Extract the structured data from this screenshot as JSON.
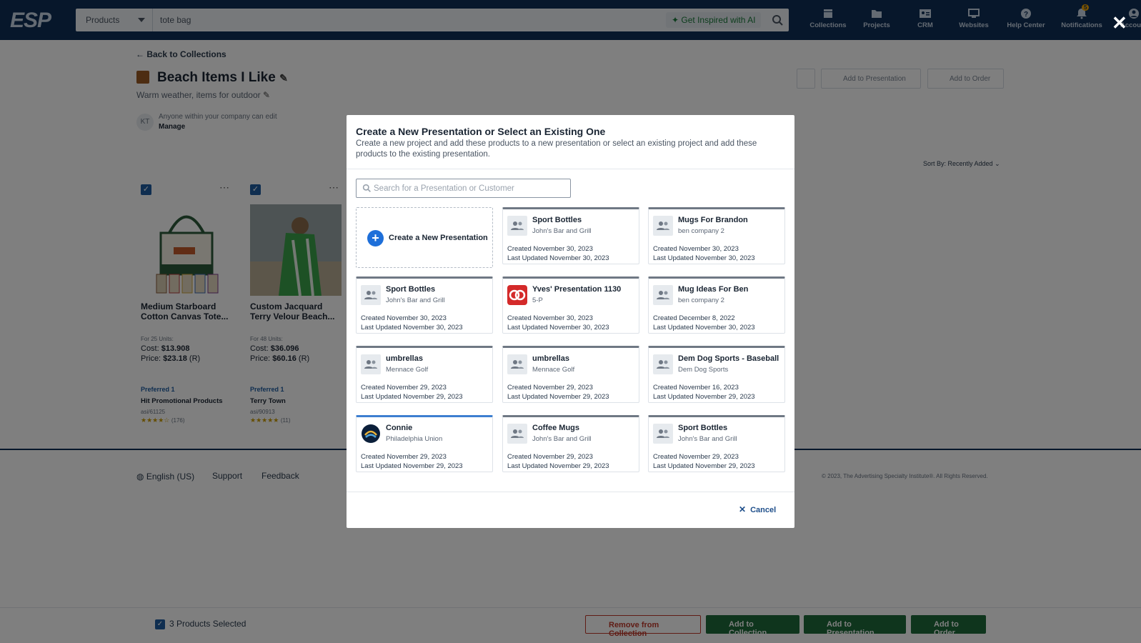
{
  "nav": {
    "logo": "ESP",
    "search_category": "Products",
    "search_query": "tote bag",
    "ai_button": "Get Inspired with AI",
    "items": [
      {
        "label": "Collections",
        "icon": "collections-icon"
      },
      {
        "label": "Projects",
        "icon": "folder-icon"
      },
      {
        "label": "CRM",
        "icon": "contact-card-icon"
      },
      {
        "label": "Websites",
        "icon": "monitor-icon"
      },
      {
        "label": "Help Center",
        "icon": "help-icon"
      },
      {
        "label": "Notifications",
        "icon": "bell-icon"
      },
      {
        "label": "Account",
        "icon": "account-icon"
      }
    ],
    "notification_count": "5"
  },
  "collection": {
    "back_link": "Back to Collections",
    "title": "Beach Items I Like",
    "description": "Warm weather, items for outdoor",
    "avatar_initials": "KT",
    "access_text": "Anyone within your company can edit",
    "manage_link": "Manage",
    "sort_label": "Sort By: Recently Added",
    "header_buttons": [
      "Add to Presentation",
      "Add to Order"
    ]
  },
  "products": [
    {
      "name": "Medium Starboard Cotton Canvas Tote...",
      "units": "For 25 Units:",
      "cost_label": "Cost:",
      "cost": "$13.908",
      "price_label": "Price:",
      "price": "$23.18",
      "price_suffix": "(R)",
      "preferred": "Preferred 1",
      "supplier": "Hit Promotional Products",
      "asi": "asi/61125",
      "stars": "★★★★☆",
      "rating_count": "(176)"
    },
    {
      "name": "Custom Jacquard Terry Velour Beach...",
      "units": "For 48 Units:",
      "cost_label": "Cost:",
      "cost": "$36.096",
      "price_label": "Price:",
      "price": "$60.16",
      "price_suffix": "(R)",
      "preferred": "Preferred 1",
      "supplier": "Terry Town",
      "asi": "asi/90913",
      "stars": "★★★★★",
      "rating_count": "(11)"
    }
  ],
  "footer": {
    "language": "English (US)",
    "support": "Support",
    "feedback": "Feedback",
    "copyright": "© 2023, The Advertising Specialty Institute®. All Rights Reserved."
  },
  "bottom_bar": {
    "selected_text": "3 Products Selected",
    "remove": "Remove from Collection",
    "add_collection": "Add to Collection",
    "add_presentation": "Add to Presentation",
    "add_order": "Add to Order"
  },
  "modal": {
    "title": "Create a New Presentation or Select an Existing One",
    "subtitle": "Create a new project and add these products to a new presentation or select an existing project and add these products to the existing presentation.",
    "search_placeholder": "Search for a Presentation or Customer",
    "create_label": "Create a New Presentation",
    "cancel": "Cancel",
    "presentations": [
      {
        "name": "Sport Bottles",
        "customer": "John's Bar and Grill",
        "created": "Created November 30, 2023",
        "updated": "Last Updated November 30, 2023"
      },
      {
        "name": "Mugs For Brandon",
        "customer": "ben company 2",
        "created": "Created November 30, 2023",
        "updated": "Last Updated November 30, 2023"
      },
      {
        "name": "Sport Bottles",
        "customer": "John's Bar and Grill",
        "created": "Created November 30, 2023",
        "updated": "Last Updated November 30, 2023"
      },
      {
        "name": "Yves' Presentation 1130",
        "customer": "5-P",
        "created": "Created November 30, 2023",
        "updated": "Last Updated November 30, 2023"
      },
      {
        "name": "Mug Ideas For Ben",
        "customer": "ben company 2",
        "created": "Created December 8, 2022",
        "updated": "Last Updated November 30, 2023"
      },
      {
        "name": "umbrellas",
        "customer": "Mennace Golf",
        "created": "Created November 29, 2023",
        "updated": "Last Updated November 29, 2023"
      },
      {
        "name": "umbrellas",
        "customer": "Mennace Golf",
        "created": "Created November 29, 2023",
        "updated": "Last Updated November 29, 2023"
      },
      {
        "name": "Dem Dog Sports - Baseball",
        "customer": "Dem Dog Sports",
        "created": "Created November 16, 2023",
        "updated": "Last Updated November 29, 2023"
      },
      {
        "name": "Connie",
        "customer": "Philadelphia Union",
        "created": "Created November 29, 2023",
        "updated": "Last Updated November 29, 2023"
      },
      {
        "name": "Coffee Mugs",
        "customer": "John's Bar and Grill",
        "created": "Created November 29, 2023",
        "updated": "Last Updated November 29, 2023"
      },
      {
        "name": "Sport Bottles",
        "customer": "John's Bar and Grill",
        "created": "Created November 29, 2023",
        "updated": "Last Updated November 29, 2023"
      }
    ]
  },
  "colors": {
    "nav_bg": "#0f2f57",
    "primary_blue": "#1e6fd9",
    "green": "#1e6b3a",
    "danger": "#c0392b"
  }
}
